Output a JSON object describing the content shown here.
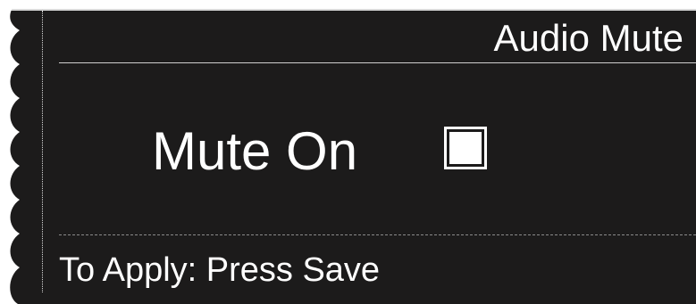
{
  "header": {
    "title": "Audio Mute"
  },
  "setting": {
    "label": "Mute On",
    "checkbox_icon": "checkbox-icon"
  },
  "footer": {
    "instruction": "To Apply: Press Save"
  },
  "colors": {
    "panel_background": "#1c1b1b",
    "text": "#ffffff",
    "divider": "#cfcfcf"
  }
}
